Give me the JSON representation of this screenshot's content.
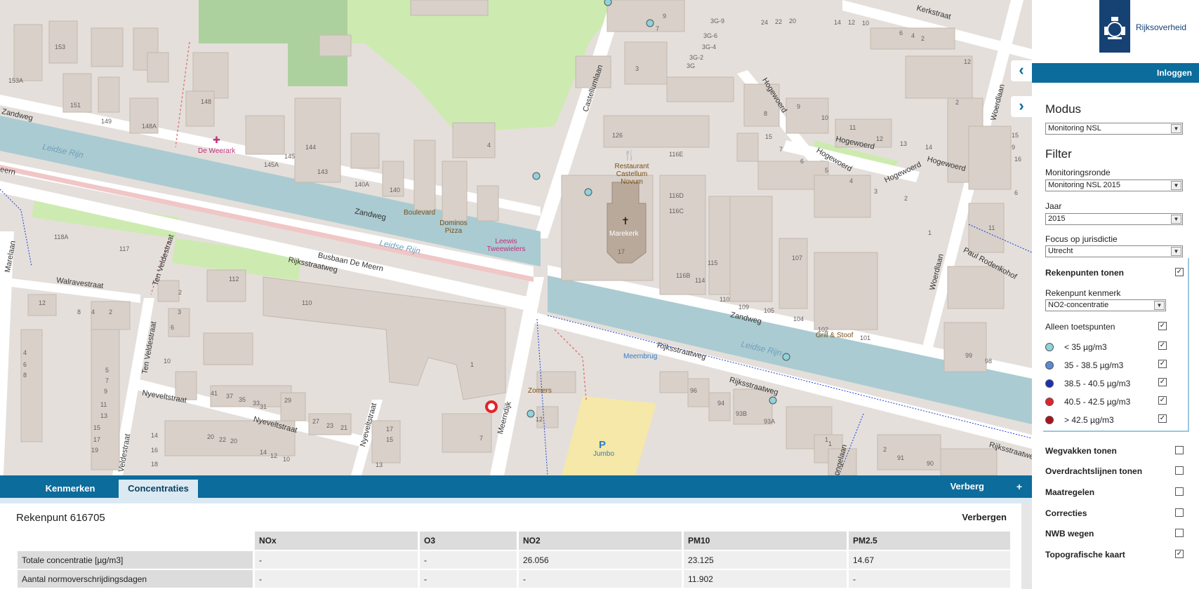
{
  "map": {
    "streets": {
      "zandweg_1": "Zandweg",
      "zandweg_2": "Zandweg",
      "zandweg_3": "Zandweg",
      "meern": "eern",
      "leidse_rijn_1": "Leidse Rijn",
      "leidse_rijn_2": "Leidse Rijn",
      "leidse_rijn_3": "Leidse Rijn",
      "busbaan": "Busbaan De Meern",
      "rijksstraatweg_1": "Rijksstraatweg",
      "rijksstraatweg_2": "Rijksstraatweg",
      "rijksstraatweg_3": "Rijksstraatweg",
      "rijksstraatweg_4": "Rijksstraatweg",
      "walravestraat": "Walravestraat",
      "ten_veldestraat_1": "Ten Veldestraat",
      "ten_veldestraat_2": "Ten Veldestraat",
      "marelaan": "Marelaan",
      "veldestraat": "Veldestraat",
      "nyeveltstraat_1": "Nyeveltstraat",
      "nyeveltstraat_2": "Nyeveltstraat",
      "nyeveltstraat_3": "Nyeveltstraat",
      "meerndijk": "Meerndijk",
      "castellumlaan": "Castellumlaan",
      "kerkstraat": "Kerkstraat",
      "hogewoerd_1": "Hogewoerd",
      "hogewoerd_2": "Hogewoerd",
      "hogewoerd_3": "Hogewoerd",
      "hogewoerd_4": "Hogewoerd",
      "hogewoerd_5": "Hogewoerd",
      "woerdlaan_1": "Woerdlaan",
      "woerdlaan_2": "Woerdlaan",
      "paul_rodenkohof": "Paul Rodenkohof",
      "longelaan": "ongelaan"
    },
    "pois": {
      "de_weerark": "De Weerark",
      "boulevard": "Boulevard",
      "dominos": "Dominos Pizza",
      "leewis": "Leewis Tweewielers",
      "restaurant": "Restaurant Castellum Novum",
      "marekerk": "Marekerk",
      "grill": "Grill & Stoof",
      "meernbrug": "Meernbrug",
      "zomers": "Zomers",
      "jumbo": "Jumbo",
      "parking": "P"
    },
    "house_numbers": [
      "153",
      "153A",
      "151",
      "149",
      "148",
      "148A",
      "145",
      "145A",
      "144",
      "143",
      "140A",
      "140",
      "4",
      "118A",
      "117",
      "112",
      "110",
      "2",
      "3",
      "6",
      "12",
      "8",
      "4",
      "2",
      "4",
      "6",
      "8",
      "10",
      "1",
      "41",
      "37",
      "35",
      "33",
      "31",
      "29",
      "27",
      "23",
      "21",
      "17",
      "15",
      "13",
      "14",
      "16",
      "18",
      "20",
      "22",
      "20",
      "18",
      "14",
      "12",
      "10",
      "5",
      "7",
      "9",
      "11",
      "13",
      "15",
      "17",
      "19",
      "7",
      "12",
      "96",
      "94",
      "93B",
      "93A",
      "1",
      "2",
      "91",
      "90",
      "3",
      "7",
      "9",
      "116E",
      "116D",
      "116C",
      "116B",
      "115",
      "114",
      "110",
      "109",
      "107",
      "105",
      "104",
      "102",
      "101",
      "99",
      "98",
      "3G-9",
      "3G-6",
      "3G-4",
      "3G-2",
      "3G",
      "24",
      "22",
      "20",
      "14",
      "12",
      "10",
      "6",
      "4",
      "2",
      "12",
      "8",
      "9",
      "10",
      "11",
      "12",
      "13",
      "14",
      "15",
      "7",
      "6",
      "5",
      "4",
      "3",
      "2",
      "1",
      "2",
      "6",
      "11",
      "9",
      "15",
      "16",
      "17",
      "126",
      "1",
      "1"
    ]
  },
  "bottom": {
    "tabs": [
      "Kenmerken",
      "Concentraties"
    ],
    "hide_label": "Verberg",
    "plus": "+",
    "title": "Rekenpunt 616705",
    "hide_link": "Verbergen",
    "table": {
      "columns": [
        "NOx",
        "O3",
        "NO2",
        "PM10",
        "PM2.5"
      ],
      "rows": [
        {
          "label": "Totale concentratie [µg/m3]",
          "values": [
            "-",
            "-",
            "26.056",
            "23.125",
            "14.67"
          ]
        },
        {
          "label": "Aantal normoverschrijdingsdagen",
          "values": [
            "-",
            "-",
            "-",
            "11.902",
            "-"
          ]
        }
      ]
    }
  },
  "sidebar": {
    "logo_text": "Rijksoverheid",
    "login": "Inloggen",
    "modus_title": "Modus",
    "modus_value": "Monitoring NSL",
    "filter_title": "Filter",
    "monitoringsronde_label": "Monitoringsronde",
    "monitoringsronde_value": "Monitoring NSL 2015",
    "jaar_label": "Jaar",
    "jaar_value": "2015",
    "focus_label": "Focus op jurisdictie",
    "focus_value": "Utrecht",
    "rekenpunten_label": "Rekenpunten tonen",
    "kenmerk_label": "Rekenpunt kenmerk",
    "kenmerk_value": "NO2-concentratie",
    "alleen_label": "Alleen toetspunten",
    "legend": [
      {
        "label": "< 35 µg/m3",
        "color": "#8fd3dc"
      },
      {
        "label": "35 - 38.5 µg/m3",
        "color": "#5b8ad0"
      },
      {
        "label": "38.5 - 40.5 µg/m3",
        "color": "#1f2fb0"
      },
      {
        "label": "40.5 - 42.5 µg/m3",
        "color": "#e3232a"
      },
      {
        "label": "> 42.5 µg/m3",
        "color": "#b01018"
      }
    ],
    "layers": [
      {
        "label": "Wegvakken tonen",
        "checked": false
      },
      {
        "label": "Overdrachtslijnen tonen",
        "checked": false
      },
      {
        "label": "Maatregelen",
        "checked": false
      },
      {
        "label": "Correcties",
        "checked": false
      },
      {
        "label": "NWB wegen",
        "checked": false
      },
      {
        "label": "Topografische kaart",
        "checked": true
      }
    ],
    "check_mark": "✓"
  },
  "colors": {
    "accent": "#0c6c9b",
    "water": "#aacbd1",
    "building": "#d8d0c9",
    "grass": "#cdebb0",
    "road": "#ffffff",
    "marker": "#e3232a"
  }
}
